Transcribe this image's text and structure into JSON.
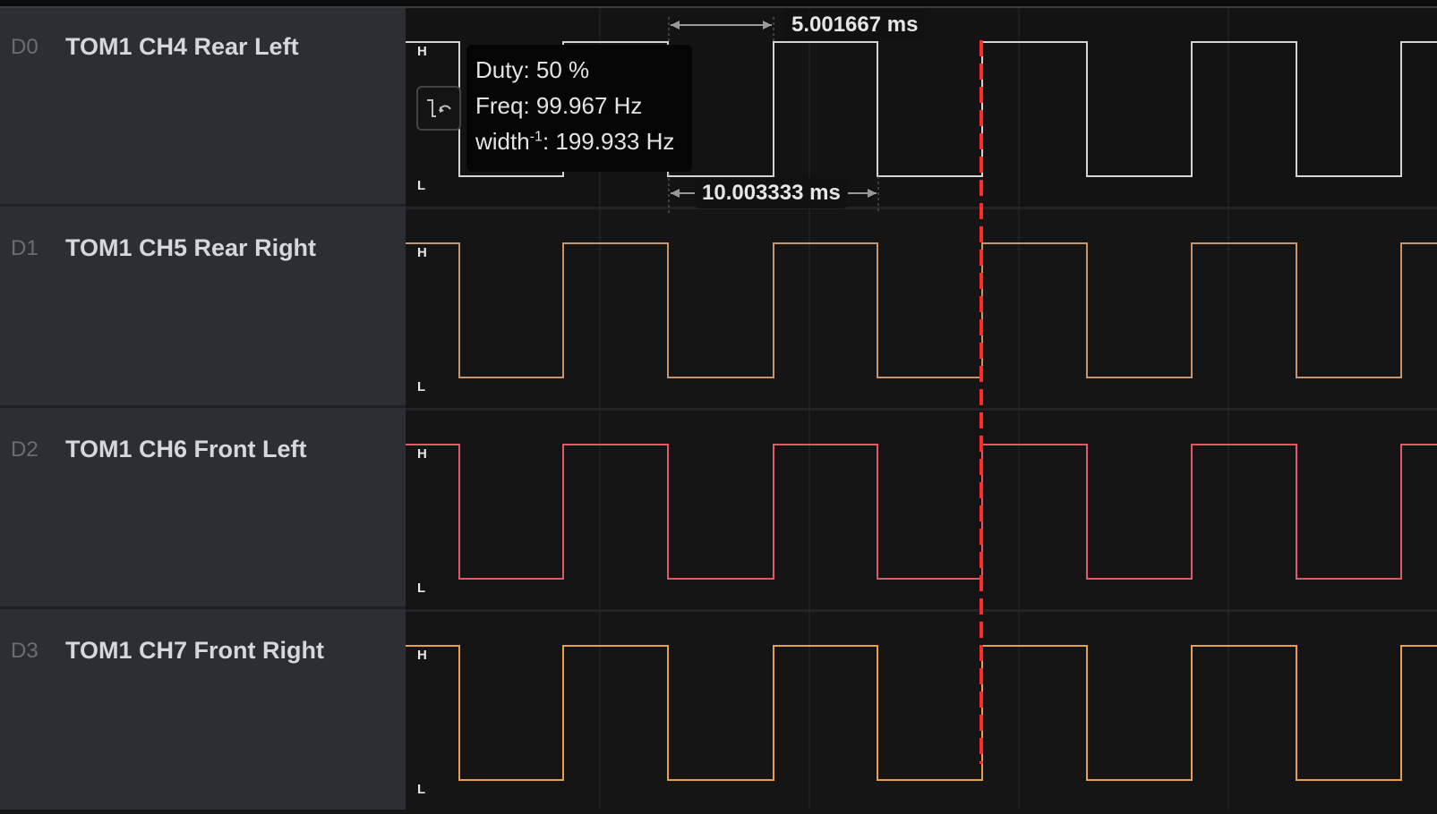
{
  "channels": [
    {
      "id": "D0",
      "name": "TOM1 CH4 Rear Left",
      "color": "#d4d4d4"
    },
    {
      "id": "D1",
      "name": "TOM1 CH5 Rear Right",
      "color": "#c7956b"
    },
    {
      "id": "D2",
      "name": "TOM1 CH6 Front Left",
      "color": "#e05a66"
    },
    {
      "id": "D3",
      "name": "TOM1 CH7 Front Right",
      "color": "#e6a04c"
    }
  ],
  "level_high": "H",
  "level_low": "L",
  "measurements": {
    "pulse_width": "5.001667 ms",
    "period": "10.003333 ms"
  },
  "tooltip": {
    "duty": "Duty: 50 %",
    "freq": "Freq: 99.967 Hz",
    "width_prefix": "width",
    "width_sup": "-1",
    "width_value": ": 199.933 Hz"
  },
  "cursor_color": "#ff2a2a",
  "edge_button_icon": "edge-trigger-icon"
}
